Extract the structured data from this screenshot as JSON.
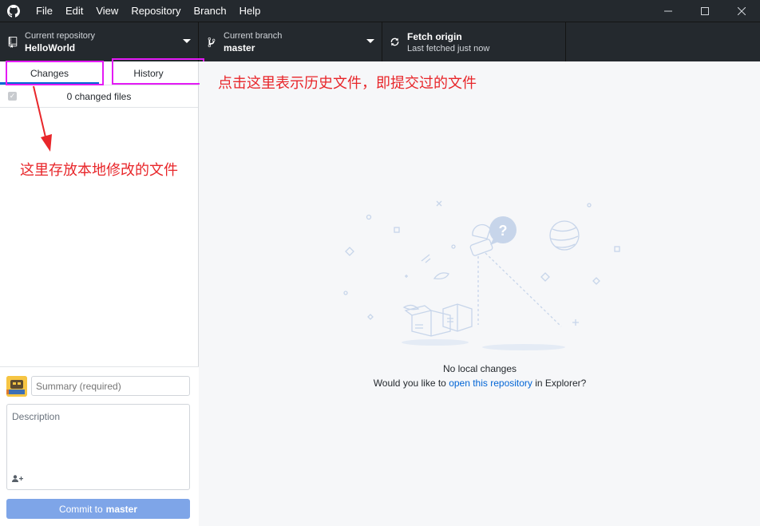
{
  "menu": {
    "items": [
      "File",
      "Edit",
      "View",
      "Repository",
      "Branch",
      "Help"
    ]
  },
  "window_controls": {
    "minimize": "—",
    "maximize": "☐",
    "close": "✕"
  },
  "toolbar": {
    "repo_label": "Current repository",
    "repo_value": "HelloWorld",
    "branch_label": "Current branch",
    "branch_value": "master",
    "fetch_title": "Fetch origin",
    "fetch_sub": "Last fetched just now"
  },
  "sidebar": {
    "tabs": [
      "Changes",
      "History"
    ],
    "active_tab": "Changes",
    "changed_files": "0 changed files",
    "summary_placeholder": "Summary (required)",
    "description_placeholder": "Description",
    "commit_prefix": "Commit to",
    "commit_branch": "master"
  },
  "main": {
    "empty_title": "No local changes",
    "empty_sub_before": "Would you like to ",
    "empty_sub_link": "open this repository",
    "empty_sub_after": " in Explorer?"
  },
  "annotations": {
    "history_note": "点击这里表示历史文件，即提交过的文件",
    "changes_note": "这里存放本地修改的文件",
    "annotation_color": "#e8262a",
    "highlight_color": "#e41bf5"
  },
  "colors": {
    "titlebar": "#24292e",
    "accent": "#0366d6",
    "commit_button": "#7ea5e8"
  }
}
